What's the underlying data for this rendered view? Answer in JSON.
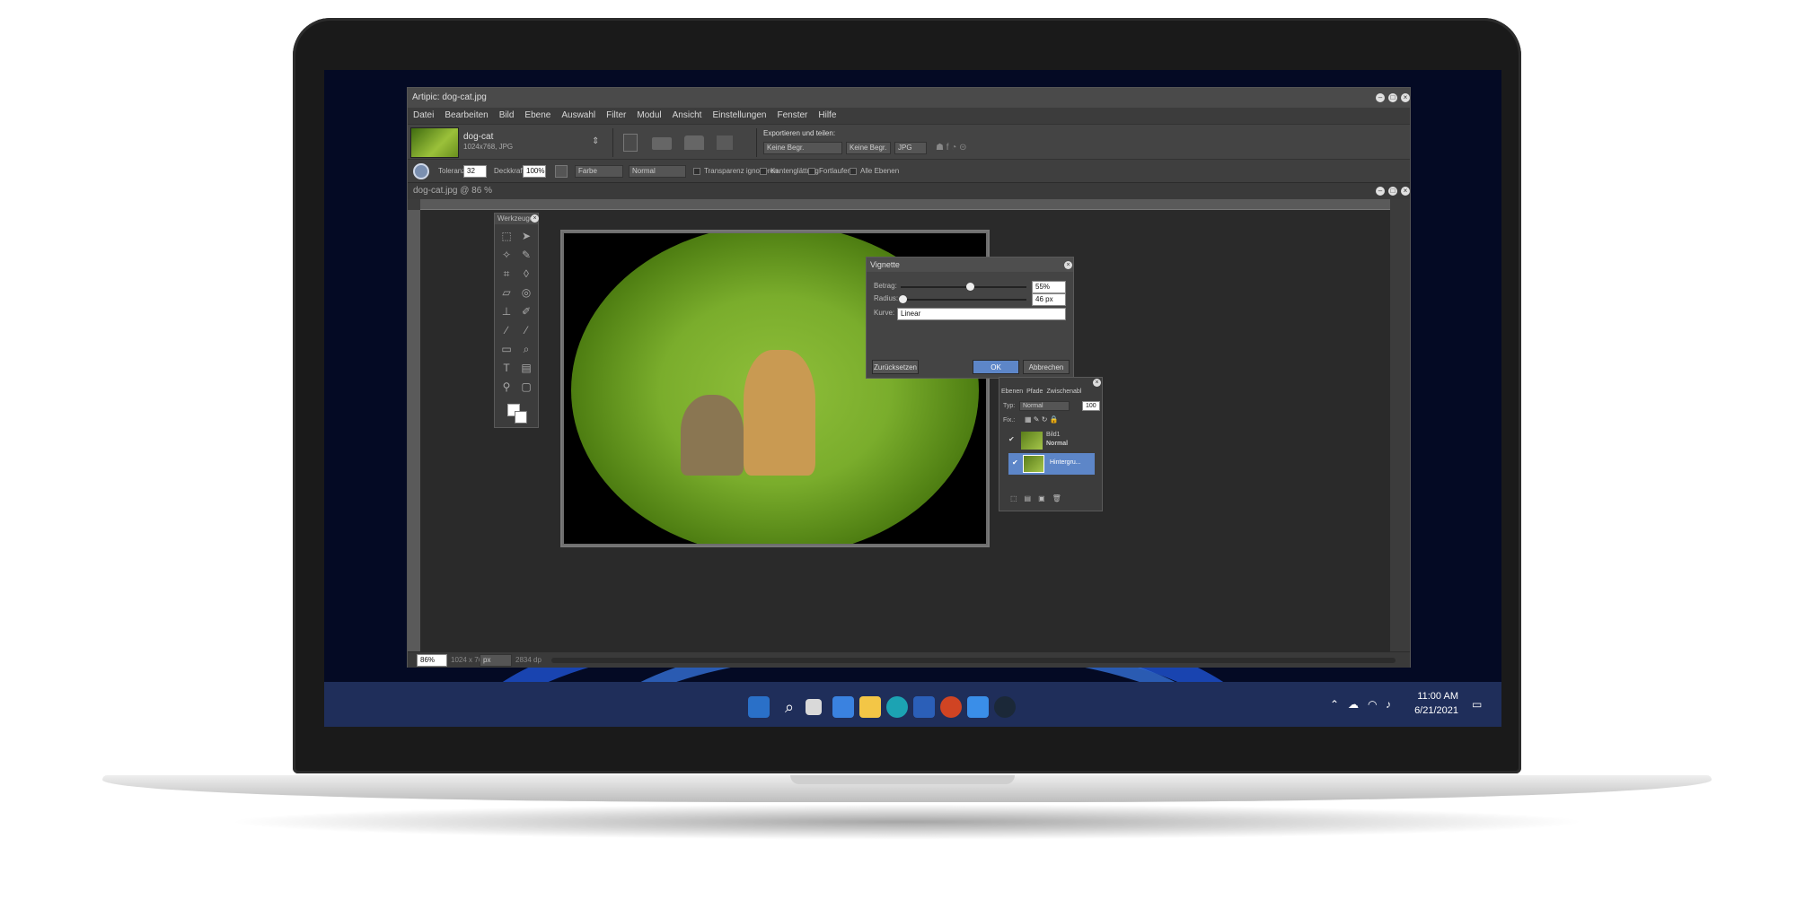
{
  "app": {
    "title": "Artipic: dog-cat.jpg",
    "menu": [
      "Datei",
      "Bearbeiten",
      "Bild",
      "Ebene",
      "Auswahl",
      "Filter",
      "Modul",
      "Ansicht",
      "Einstellungen",
      "Fenster",
      "Hilfe"
    ]
  },
  "document": {
    "name": "dog-cat",
    "info": "1024x768, JPG",
    "tab_title": "dog-cat.jpg @ 86 %"
  },
  "export": {
    "label": "Exportieren und teilen:",
    "select1": "Keine Begr.",
    "select2": "Keine Begr.",
    "format": "JPG"
  },
  "options": {
    "tolerance_label": "Toleranz:",
    "tolerance_value": "32",
    "opacity_label": "Deckkraft:",
    "opacity_value": "100%",
    "color_select": "Farbe",
    "mode_select": "Normal",
    "check_transparency": "Transparenz ignorieren",
    "check_antialias": "Kantenglättung",
    "check_contiguous": "Fortlaufend",
    "check_all_layers": "Alle Ebenen"
  },
  "tools_panel": {
    "title": "Werkzeuge"
  },
  "vignette": {
    "title": "Vignette",
    "amount_label": "Betrag:",
    "amount_value": "55%",
    "amount_level": 0.55,
    "radius_label": "Radius:",
    "radius_value": "46 px",
    "curve_label": "Kurve:",
    "curve_value": "Linear",
    "reset_label": "Zurücksetzen",
    "ok_label": "OK",
    "cancel_label": "Abbrechen"
  },
  "layers": {
    "tabs": [
      "Ebenen",
      "Pfade",
      "Zwischenabl"
    ],
    "type_label": "Typ:",
    "type_value": "Normal",
    "opacity_value": "100",
    "fix_label": "Fix.:",
    "items": [
      {
        "name": "Bild1",
        "mode": "Normal"
      },
      {
        "name": "Hintergru..."
      }
    ]
  },
  "status": {
    "zoom": "86%",
    "size": "1024 x 768",
    "unit": "px",
    "resolution": "2834 dp"
  },
  "taskbar": {
    "time": "11:00 AM",
    "date": "6/21/2021"
  },
  "colors": {
    "accent": "#5d86c8",
    "taskbar": "#1f2e5a"
  }
}
